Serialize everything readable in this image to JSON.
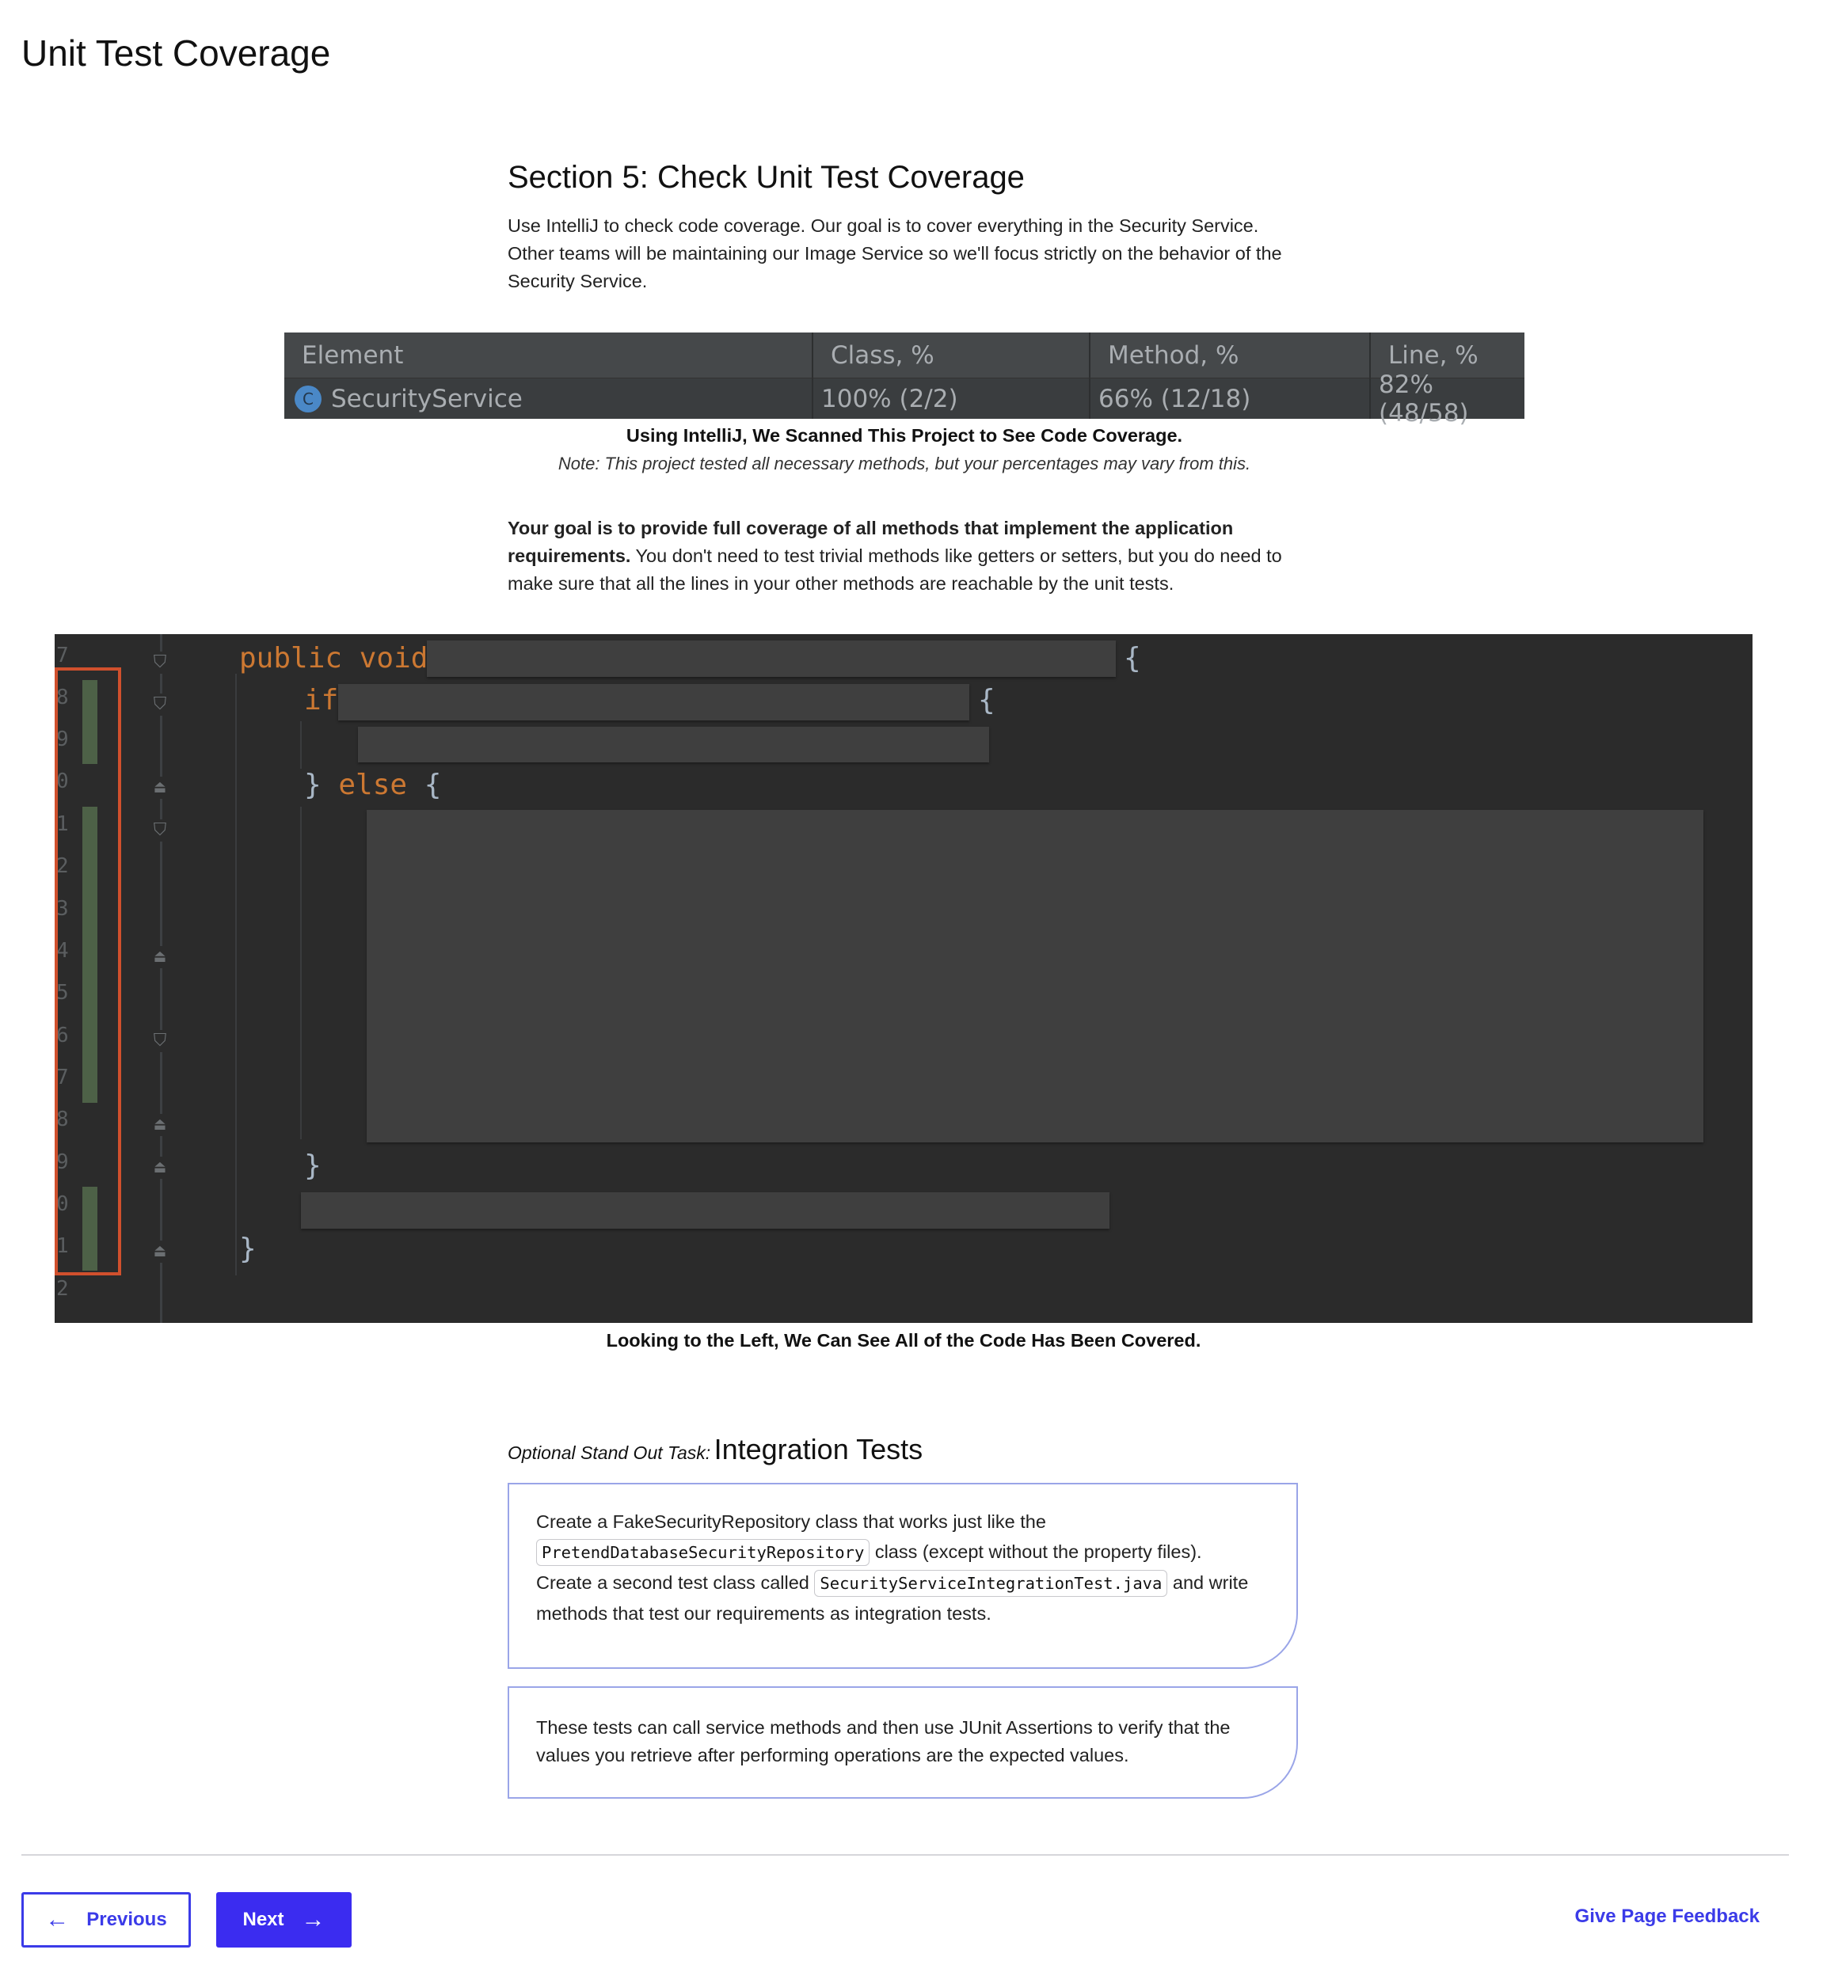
{
  "page": {
    "title": "Unit Test Coverage"
  },
  "section": {
    "title": "Section 5: Check Unit Test Coverage",
    "intro": "Use IntelliJ to check code coverage. Our goal is to cover everything in the Security Service. Other teams will be maintaining our Image Service so we'll focus strictly on the behavior of the Security Service."
  },
  "coverage_table": {
    "headers": [
      "Element",
      "Class, %",
      "Method, %",
      "Line, %"
    ],
    "row": {
      "icon": "C",
      "element": "SecurityService",
      "class_pct": "100% (2/2)",
      "method_pct": "66% (12/18)",
      "line_pct": "82% (48/58)"
    },
    "caption": "Using IntelliJ, We Scanned This Project to See Code Coverage.",
    "note": "Note: This project tested all necessary methods, but your percentages may vary from this."
  },
  "goal": {
    "bold": "Your goal is to provide full coverage of all methods that implement the application requirements.",
    "rest": " You don't need to test trivial methods like getters or setters, but you do need to make sure that all the lines in your other methods are reachable by the unit tests."
  },
  "code_view": {
    "line_numbers": [
      "7",
      "8",
      "9",
      "0",
      "1",
      "2",
      "3",
      "4",
      "5",
      "6",
      "7",
      "8",
      "9",
      "0",
      "1",
      "2"
    ],
    "kw_public": "public",
    "kw_void": "void",
    "kw_if": "if",
    "kw_else": "else",
    "brace_open": "{",
    "brace_close": "}",
    "else_open": "} ",
    "caption": "Looking to the Left, We Can See All of the Code Has Been Covered."
  },
  "optional_task": {
    "kicker": "Optional Stand Out Task:",
    "title": "Integration Tests",
    "card1": {
      "t1": "Create a FakeSecurityRepository class that works just like the ",
      "code1": "PretendDatabaseSecurityRepository",
      "t2": " class (except without the property files).",
      "t3": "Create a second test class called ",
      "code2": "SecurityServiceIntegrationTest.java",
      "t4": " and write methods that test our requirements as integration tests."
    },
    "card2": "These tests can call service methods and then use JUnit Assertions to verify that the values you retrieve after performing operations are the expected values."
  },
  "footer": {
    "previous_label": "Previous",
    "next_label": "Next",
    "feedback_label": "Give Page Feedback",
    "accent_color": "#3b3be8"
  }
}
